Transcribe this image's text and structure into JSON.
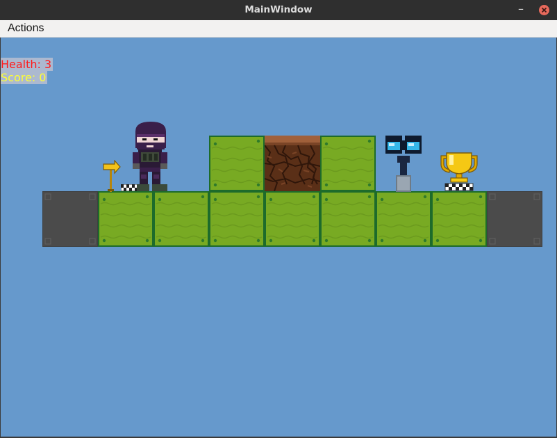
{
  "window": {
    "title": "MainWindow"
  },
  "menu": {
    "actions_label": "Actions"
  },
  "hud": {
    "health_label": "Health: 3",
    "score_label": "Score: 0"
  },
  "colors": {
    "sky": "#6699cc",
    "grass": "#77aa22",
    "grass_border": "#1d6b2b",
    "stone": "#4a4a4a",
    "dirt": "#6b3a1e",
    "health_text": "#ff1a1a",
    "score_text": "#ffff33"
  },
  "icons": {
    "start_sign": "arrow-sign-icon",
    "player": "ninja-player-icon",
    "checkpoint": "binocular-checkpoint-icon",
    "goal": "trophy-icon"
  }
}
